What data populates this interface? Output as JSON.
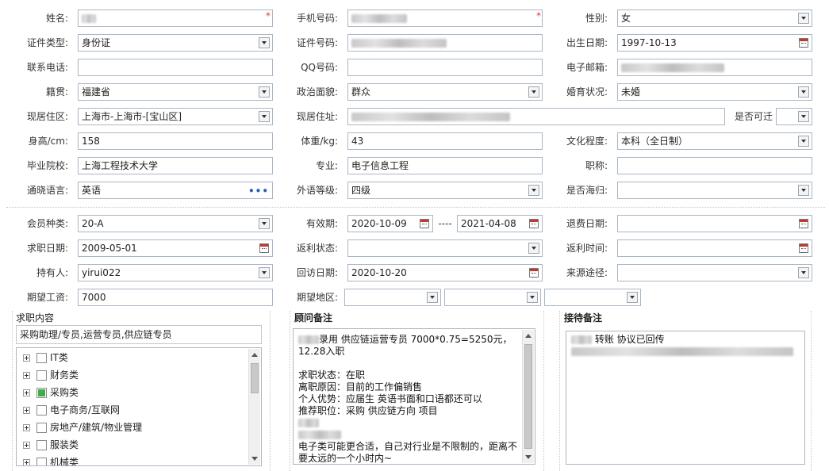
{
  "colors": {
    "border": "#a9b7c6",
    "required": "#e53935",
    "checked": "#3fae49",
    "dots": "#2b63b6"
  },
  "profile": {
    "name_label": "姓名:",
    "phone_label": "手机号码:",
    "gender_label": "性别:",
    "gender_value": "女",
    "id_type_label": "证件类型:",
    "id_type_value": "身份证",
    "id_no_label": "证件号码:",
    "birth_label": "出生日期:",
    "birth_value": "1997-10-13",
    "contact_label": "联系电话:",
    "qq_label": "QQ号码:",
    "email_label": "电子邮箱:",
    "native_label": "籍贯:",
    "native_value": "福建省",
    "political_label": "政治面貌:",
    "political_value": "群众",
    "marital_label": "婚育状况:",
    "marital_value": "未婚",
    "residence_area_label": "现居住区:",
    "residence_area_value": "上海市-上海市-[宝山区]",
    "residence_addr_label": "现居住址:",
    "relocate_label": "是否可迁",
    "height_label": "身高/cm:",
    "height_value": "158",
    "weight_label": "体重/kg:",
    "weight_value": "43",
    "education_label": "文化程度:",
    "education_value": "本科（全日制）",
    "school_label": "毕业院校:",
    "school_value": "上海工程技术大学",
    "major_label": "专业:",
    "major_value": "电子信息工程",
    "title_label": "职称:",
    "language_label": "通晓语言:",
    "language_value": "英语",
    "lang_level_label": "外语等级:",
    "lang_level_value": "四级",
    "overseas_label": "是否海归:"
  },
  "membership": {
    "member_type_label": "会员种类:",
    "member_type_value": "20-A",
    "valid_label": "有效期:",
    "valid_from": "2020-10-09",
    "valid_sep": "----",
    "valid_to": "2021-04-08",
    "refund_date_label": "退费日期:",
    "job_date_label": "求职日期:",
    "job_date_value": "2009-05-01",
    "rebate_status_label": "返利状态:",
    "rebate_time_label": "返利时间:",
    "holder_label": "持有人:",
    "holder_value": "yirui022",
    "visit_date_label": "回访日期:",
    "visit_date_value": "2020-10-20",
    "source_label": "来源途径:",
    "salary_label": "期望工资:",
    "salary_value": "7000",
    "region_label": "期望地区:"
  },
  "job_content": {
    "title": "求职内容",
    "summary": "采购助理/专员,运营专员,供应链专员",
    "categories": [
      {
        "label": "IT类",
        "checked": false
      },
      {
        "label": "财务类",
        "checked": false
      },
      {
        "label": "采购类",
        "checked": true
      },
      {
        "label": "电子商务/互联网",
        "checked": false
      },
      {
        "label": "房地产/建筑/物业管理",
        "checked": false
      },
      {
        "label": "服装类",
        "checked": false
      },
      {
        "label": "机械类",
        "checked": false
      }
    ]
  },
  "advisor_notes": {
    "title": "顾问备注",
    "lines": [
      "录用 供应链运营专员  7000*0.75=5250元，",
      "12.28入职",
      "",
      "求职状态：在职",
      "离职原因：目前的工作偏销售",
      "个人优势：应届生  英语书面和口语都还可以",
      "推荐职位：采购 供应链方向 项目",
      "",
      "",
      "电子类可能更合适，自己对行业是不限制的，距离不",
      "要太远的一个小时内~"
    ]
  },
  "reception_notes": {
    "title": "接待备注",
    "line1": "转账 协议已回传"
  }
}
